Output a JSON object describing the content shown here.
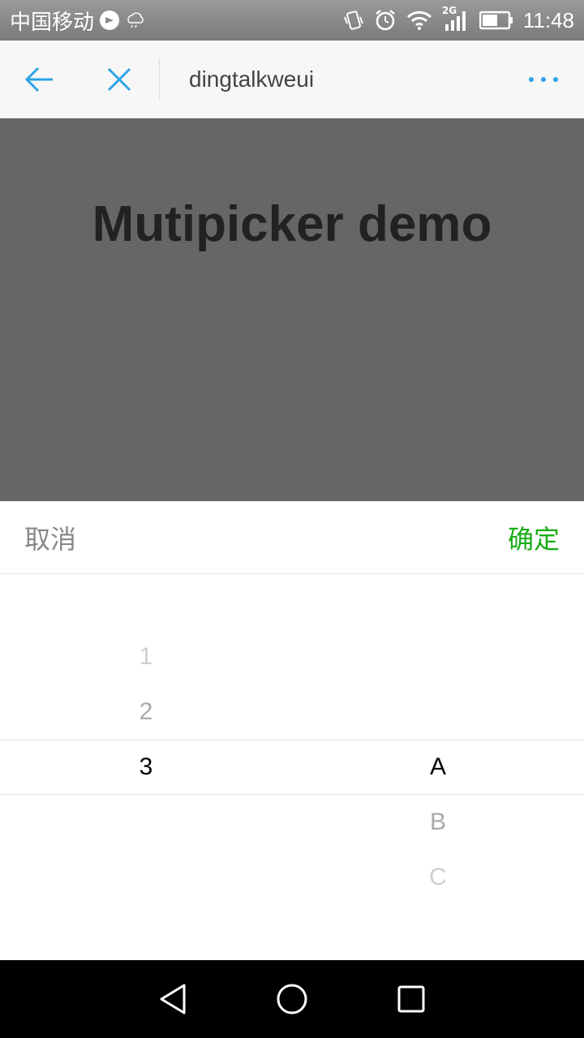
{
  "status_bar": {
    "carrier": "中国移动",
    "network": "2G",
    "time": "11:48"
  },
  "nav": {
    "title": "dingtalkweui",
    "accent_color": "#2ea3e8"
  },
  "page": {
    "title": "Mutipicker demo"
  },
  "picker": {
    "cancel_label": "取消",
    "confirm_label": "确定",
    "confirm_color": "#1aad19",
    "column1": [
      "1",
      "2",
      "3"
    ],
    "column2": [
      "A",
      "B",
      "C"
    ],
    "selected": [
      "3",
      "A"
    ]
  },
  "icons": {
    "back": "arrow-left-icon",
    "close": "close-icon",
    "more": "more-dots-icon",
    "android_back": "triangle-back-icon",
    "android_home": "circle-home-icon",
    "android_recent": "square-recent-icon"
  }
}
